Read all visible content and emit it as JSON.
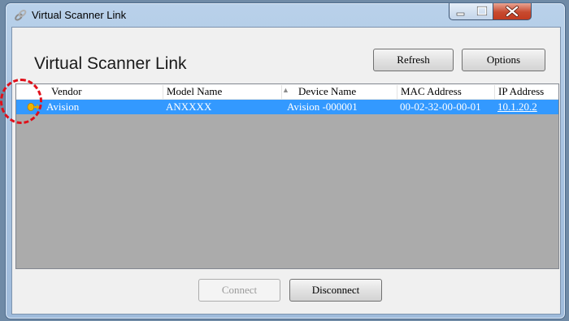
{
  "window": {
    "title": "Virtual Scanner Link"
  },
  "header": {
    "title": "Virtual Scanner Link",
    "refresh_label": "Refresh",
    "options_label": "Options"
  },
  "list": {
    "columns": [
      "Vendor",
      "Model Name",
      "Device Name",
      "MAC Address",
      "IP Address"
    ],
    "sorted_column": "Device Name",
    "rows": [
      {
        "vendor": "Avision",
        "model": "ANXXXX",
        "device": "Avision -000001",
        "mac": "00-02-32-00-00-01",
        "ip": "10.1.20.2",
        "selected": true
      }
    ]
  },
  "footer": {
    "connect_label": "Connect",
    "disconnect_label": "Disconnect"
  },
  "colors": {
    "selection": "#3399ff",
    "list_background": "#ababab",
    "annotation": "#e0101a"
  }
}
